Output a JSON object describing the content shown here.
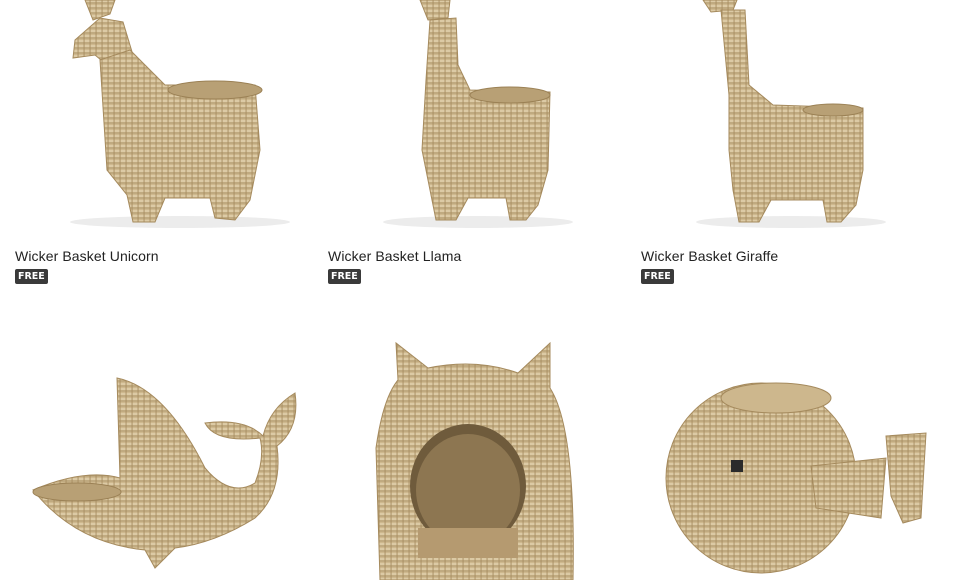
{
  "colors": {
    "badge_bg": "#3a3a3a",
    "wicker_light": "#d8c49c",
    "wicker_dark": "#9c8257"
  },
  "products": [
    {
      "title": "Wicker Basket Unicorn",
      "badge": "FREE",
      "icon": "unicorn-basket-image"
    },
    {
      "title": "Wicker Basket Llama",
      "badge": "FREE",
      "icon": "llama-basket-image"
    },
    {
      "title": "Wicker Basket Giraffe",
      "badge": "FREE",
      "icon": "giraffe-basket-image"
    },
    {
      "icon": "whale-basket-image"
    },
    {
      "icon": "cat-house-basket-image"
    },
    {
      "icon": "fish-basket-image"
    }
  ]
}
